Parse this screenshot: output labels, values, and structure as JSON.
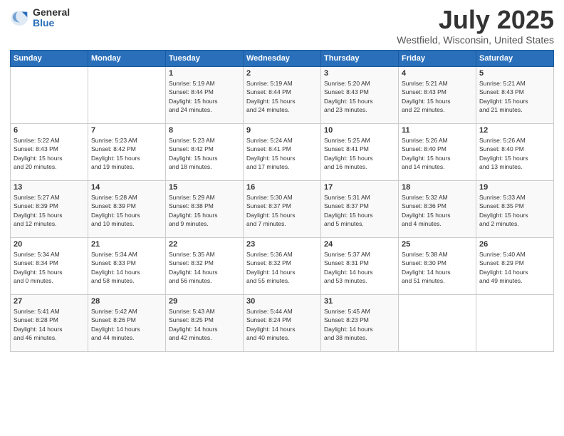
{
  "logo": {
    "general": "General",
    "blue": "Blue"
  },
  "title": "July 2025",
  "location": "Westfield, Wisconsin, United States",
  "days_of_week": [
    "Sunday",
    "Monday",
    "Tuesday",
    "Wednesday",
    "Thursday",
    "Friday",
    "Saturday"
  ],
  "weeks": [
    [
      {
        "day": "",
        "info": ""
      },
      {
        "day": "",
        "info": ""
      },
      {
        "day": "1",
        "info": "Sunrise: 5:19 AM\nSunset: 8:44 PM\nDaylight: 15 hours\nand 24 minutes."
      },
      {
        "day": "2",
        "info": "Sunrise: 5:19 AM\nSunset: 8:44 PM\nDaylight: 15 hours\nand 24 minutes."
      },
      {
        "day": "3",
        "info": "Sunrise: 5:20 AM\nSunset: 8:43 PM\nDaylight: 15 hours\nand 23 minutes."
      },
      {
        "day": "4",
        "info": "Sunrise: 5:21 AM\nSunset: 8:43 PM\nDaylight: 15 hours\nand 22 minutes."
      },
      {
        "day": "5",
        "info": "Sunrise: 5:21 AM\nSunset: 8:43 PM\nDaylight: 15 hours\nand 21 minutes."
      }
    ],
    [
      {
        "day": "6",
        "info": "Sunrise: 5:22 AM\nSunset: 8:43 PM\nDaylight: 15 hours\nand 20 minutes."
      },
      {
        "day": "7",
        "info": "Sunrise: 5:23 AM\nSunset: 8:42 PM\nDaylight: 15 hours\nand 19 minutes."
      },
      {
        "day": "8",
        "info": "Sunrise: 5:23 AM\nSunset: 8:42 PM\nDaylight: 15 hours\nand 18 minutes."
      },
      {
        "day": "9",
        "info": "Sunrise: 5:24 AM\nSunset: 8:41 PM\nDaylight: 15 hours\nand 17 minutes."
      },
      {
        "day": "10",
        "info": "Sunrise: 5:25 AM\nSunset: 8:41 PM\nDaylight: 15 hours\nand 16 minutes."
      },
      {
        "day": "11",
        "info": "Sunrise: 5:26 AM\nSunset: 8:40 PM\nDaylight: 15 hours\nand 14 minutes."
      },
      {
        "day": "12",
        "info": "Sunrise: 5:26 AM\nSunset: 8:40 PM\nDaylight: 15 hours\nand 13 minutes."
      }
    ],
    [
      {
        "day": "13",
        "info": "Sunrise: 5:27 AM\nSunset: 8:39 PM\nDaylight: 15 hours\nand 12 minutes."
      },
      {
        "day": "14",
        "info": "Sunrise: 5:28 AM\nSunset: 8:39 PM\nDaylight: 15 hours\nand 10 minutes."
      },
      {
        "day": "15",
        "info": "Sunrise: 5:29 AM\nSunset: 8:38 PM\nDaylight: 15 hours\nand 9 minutes."
      },
      {
        "day": "16",
        "info": "Sunrise: 5:30 AM\nSunset: 8:37 PM\nDaylight: 15 hours\nand 7 minutes."
      },
      {
        "day": "17",
        "info": "Sunrise: 5:31 AM\nSunset: 8:37 PM\nDaylight: 15 hours\nand 5 minutes."
      },
      {
        "day": "18",
        "info": "Sunrise: 5:32 AM\nSunset: 8:36 PM\nDaylight: 15 hours\nand 4 minutes."
      },
      {
        "day": "19",
        "info": "Sunrise: 5:33 AM\nSunset: 8:35 PM\nDaylight: 15 hours\nand 2 minutes."
      }
    ],
    [
      {
        "day": "20",
        "info": "Sunrise: 5:34 AM\nSunset: 8:34 PM\nDaylight: 15 hours\nand 0 minutes."
      },
      {
        "day": "21",
        "info": "Sunrise: 5:34 AM\nSunset: 8:33 PM\nDaylight: 14 hours\nand 58 minutes."
      },
      {
        "day": "22",
        "info": "Sunrise: 5:35 AM\nSunset: 8:32 PM\nDaylight: 14 hours\nand 56 minutes."
      },
      {
        "day": "23",
        "info": "Sunrise: 5:36 AM\nSunset: 8:32 PM\nDaylight: 14 hours\nand 55 minutes."
      },
      {
        "day": "24",
        "info": "Sunrise: 5:37 AM\nSunset: 8:31 PM\nDaylight: 14 hours\nand 53 minutes."
      },
      {
        "day": "25",
        "info": "Sunrise: 5:38 AM\nSunset: 8:30 PM\nDaylight: 14 hours\nand 51 minutes."
      },
      {
        "day": "26",
        "info": "Sunrise: 5:40 AM\nSunset: 8:29 PM\nDaylight: 14 hours\nand 49 minutes."
      }
    ],
    [
      {
        "day": "27",
        "info": "Sunrise: 5:41 AM\nSunset: 8:28 PM\nDaylight: 14 hours\nand 46 minutes."
      },
      {
        "day": "28",
        "info": "Sunrise: 5:42 AM\nSunset: 8:26 PM\nDaylight: 14 hours\nand 44 minutes."
      },
      {
        "day": "29",
        "info": "Sunrise: 5:43 AM\nSunset: 8:25 PM\nDaylight: 14 hours\nand 42 minutes."
      },
      {
        "day": "30",
        "info": "Sunrise: 5:44 AM\nSunset: 8:24 PM\nDaylight: 14 hours\nand 40 minutes."
      },
      {
        "day": "31",
        "info": "Sunrise: 5:45 AM\nSunset: 8:23 PM\nDaylight: 14 hours\nand 38 minutes."
      },
      {
        "day": "",
        "info": ""
      },
      {
        "day": "",
        "info": ""
      }
    ]
  ]
}
